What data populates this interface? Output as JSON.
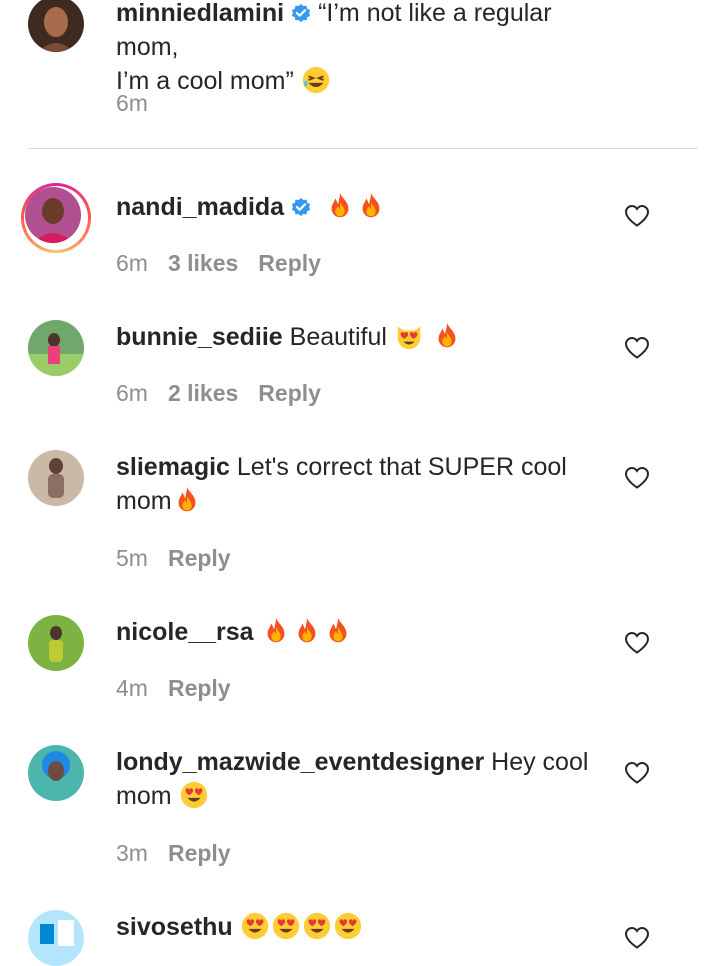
{
  "caption": {
    "username": "minniedlamini",
    "text_line1": "“I’m not like a regular mom,",
    "text_line2": "I’m a cool mom”",
    "emoji": "rofl-emoji",
    "time": "6m"
  },
  "comments": [
    {
      "username": "nandi_madida",
      "verified": true,
      "text": "",
      "emojis": [
        "fire-emoji",
        "fire-emoji"
      ],
      "time": "6m",
      "likes": "3 likes",
      "reply": "Reply",
      "story_ring": true
    },
    {
      "username": "bunnie_sediie",
      "text": "Beautiful",
      "emojis": [
        "heart-eyes-cat-emoji",
        "fire-emoji"
      ],
      "time": "6m",
      "likes": "2 likes",
      "reply": "Reply"
    },
    {
      "username": "sliemagic",
      "text": "Let's correct that SUPER cool",
      "text2": "mom",
      "emojis": [
        "fire-emoji"
      ],
      "time": "5m",
      "reply": "Reply"
    },
    {
      "username": "nicole__rsa",
      "text": "",
      "emojis": [
        "fire-emoji",
        "fire-emoji",
        "fire-emoji"
      ],
      "time": "4m",
      "reply": "Reply"
    },
    {
      "username": "londy_mazwide_eventdesigner",
      "text": "Hey cool",
      "text2": "mom",
      "emojis": [
        "heart-eyes-emoji"
      ],
      "time": "3m",
      "reply": "Reply"
    },
    {
      "username": "sivosethu",
      "text": "",
      "emojis": [
        "heart-eyes-emoji",
        "heart-eyes-emoji",
        "heart-eyes-emoji",
        "heart-eyes-emoji"
      ]
    }
  ],
  "colors": {
    "text": "#262626",
    "meta": "#8e8e8e",
    "verified": "#3897f0",
    "divider": "#dbdbdb"
  }
}
